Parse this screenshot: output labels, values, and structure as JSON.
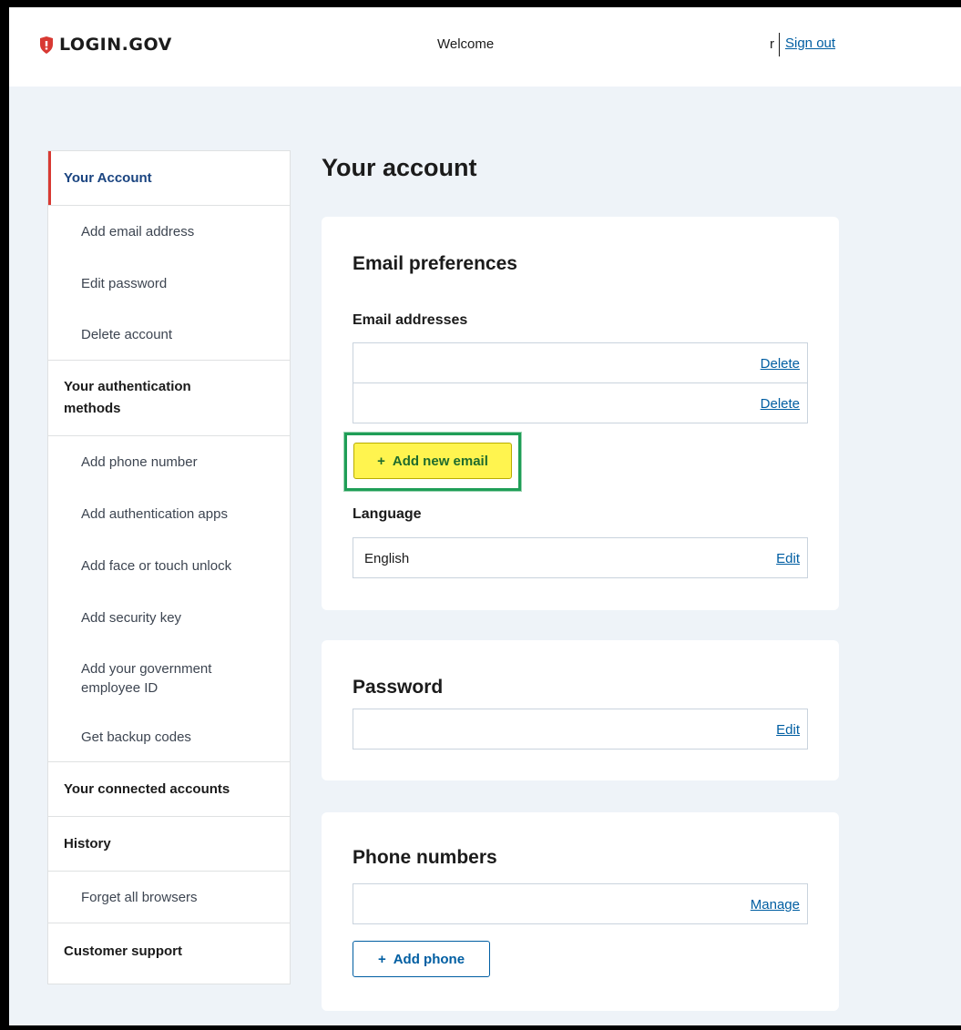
{
  "header": {
    "logo_text": "LOGIN.GOV",
    "welcome": "Welcome",
    "user_name": "r",
    "sign_out": "Sign out"
  },
  "sidebar": {
    "items": [
      {
        "label": "Your Account"
      },
      {
        "label": "Add email address"
      },
      {
        "label": "Edit password"
      },
      {
        "label": "Delete account"
      },
      {
        "label": "Your authentication methods"
      },
      {
        "label": "Add phone number"
      },
      {
        "label": "Add authentication apps"
      },
      {
        "label": "Add face or touch unlock"
      },
      {
        "label": "Add security key"
      },
      {
        "label": "Add your government employee ID"
      },
      {
        "label": "Get backup codes"
      },
      {
        "label": "Your connected accounts"
      },
      {
        "label": "History"
      },
      {
        "label": "Forget all browsers"
      },
      {
        "label": "Customer support"
      }
    ]
  },
  "main": {
    "title": "Your account",
    "email_prefs": {
      "title": "Email preferences",
      "addresses_label": "Email addresses",
      "rows": [
        {
          "value": "",
          "action": "Delete"
        },
        {
          "value": "",
          "action": "Delete"
        }
      ],
      "add_button": "Add new email",
      "language_label": "Language",
      "language_value": "English",
      "language_action": "Edit"
    },
    "password": {
      "title": "Password",
      "value": "",
      "action": "Edit"
    },
    "phone": {
      "title": "Phone numbers",
      "value": "",
      "action": "Manage",
      "add_button": "Add phone"
    }
  },
  "colors": {
    "brand_red": "#d83933",
    "link_blue": "#005ea2",
    "active_nav": "#1a4480",
    "highlight_yellow": "#fff44f",
    "highlight_border": "#1f9e57",
    "page_bg": "#eef3f8"
  },
  "icons": {
    "logo": "shield-icon",
    "add": "plus-icon"
  }
}
